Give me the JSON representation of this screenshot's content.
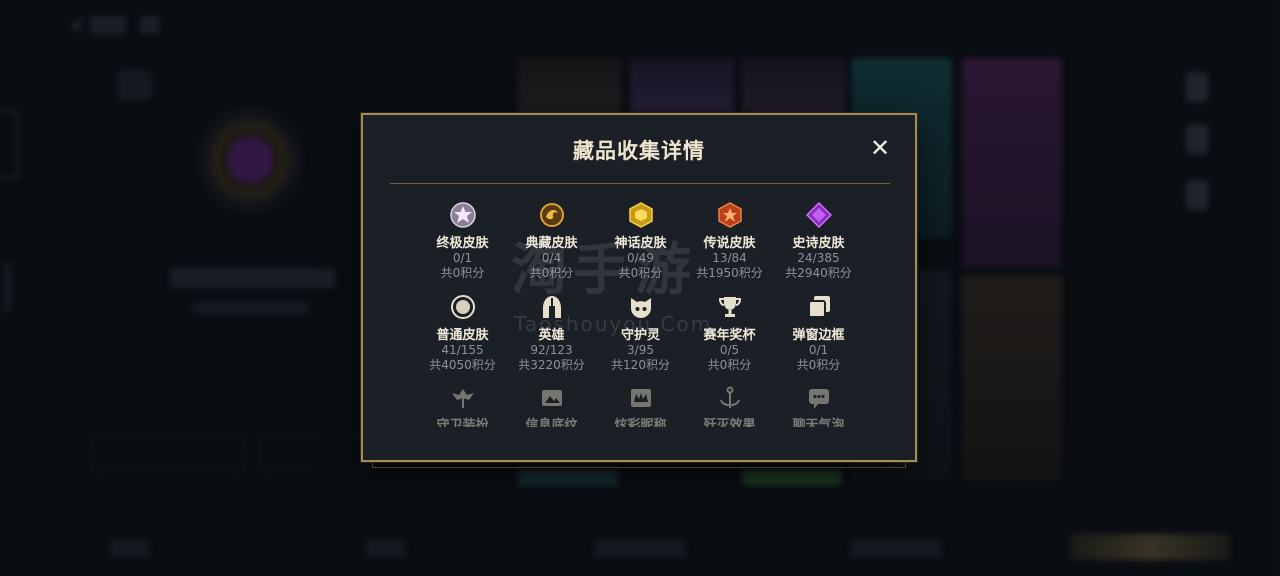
{
  "modal": {
    "title": "藏品收集详情",
    "close_glyph": "✕"
  },
  "collections": [
    {
      "label": "终极皮肤",
      "count": "0/1",
      "points": "共0积分",
      "icon": "ultimate-skin-icon"
    },
    {
      "label": "典藏皮肤",
      "count": "0/4",
      "points": "共0积分",
      "icon": "mythic-dragon-skin-icon"
    },
    {
      "label": "神话皮肤",
      "count": "0/49",
      "points": "共0积分",
      "icon": "mythic-skin-gem-icon"
    },
    {
      "label": "传说皮肤",
      "count": "13/84",
      "points": "共1950积分",
      "icon": "legendary-skin-gem-icon"
    },
    {
      "label": "史诗皮肤",
      "count": "24/385",
      "points": "共2940积分",
      "icon": "epic-skin-gem-icon"
    },
    {
      "label": "普通皮肤",
      "count": "41/155",
      "points": "共4050积分",
      "icon": "common-skin-icon"
    },
    {
      "label": "英雄",
      "count": "92/123",
      "points": "共3220积分",
      "icon": "helmet-icon"
    },
    {
      "label": "守护灵",
      "count": "3/95",
      "points": "共120积分",
      "icon": "pet-icon"
    },
    {
      "label": "赛年奖杯",
      "count": "0/5",
      "points": "共0积分",
      "icon": "trophy-icon"
    },
    {
      "label": "弹窗边框",
      "count": "0/1",
      "points": "共0积分",
      "icon": "frame-icon"
    },
    {
      "label": "守卫装扮",
      "icon": "ward-skin-icon"
    },
    {
      "label": "信息底纹",
      "icon": "profile-banner-icon"
    },
    {
      "label": "炫彩昵称",
      "icon": "colorful-name-icon"
    },
    {
      "label": "歼灭效果",
      "icon": "elimination-effect-icon"
    },
    {
      "label": "聊天气泡",
      "icon": "chat-bubble-icon"
    }
  ],
  "watermark": {
    "text": "淘手游",
    "url_text": "Taoshouyou.Com"
  },
  "colors": {
    "accent_gold": "#a58c55",
    "panel_bg": "#1a2026",
    "muted_text": "#8d9196"
  }
}
